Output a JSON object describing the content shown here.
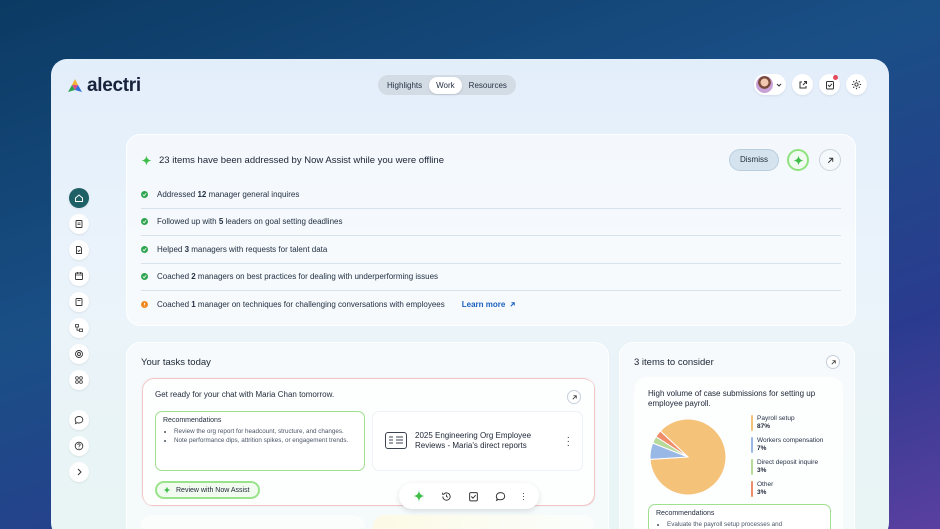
{
  "app": {
    "name": "alectri"
  },
  "nav": {
    "tabs": [
      {
        "label": "Highlights",
        "active": false
      },
      {
        "label": "Work",
        "active": true
      },
      {
        "label": "Resources",
        "active": false
      }
    ]
  },
  "assist": {
    "title": "23 items have been addressed by Now Assist while you were offline",
    "dismiss_label": "Dismiss",
    "items": [
      {
        "status": "done",
        "pre": "Addressed ",
        "num": "12",
        "post": " manager general inquires"
      },
      {
        "status": "done",
        "pre": "Followed up with ",
        "num": "5",
        "post": " leaders on goal setting deadlines"
      },
      {
        "status": "done",
        "pre": "Helped ",
        "num": "3",
        "post": " managers with requests for talent data"
      },
      {
        "status": "done",
        "pre": "Coached ",
        "num": "2",
        "post": " managers on best practices for dealing with underperforming issues"
      },
      {
        "status": "attention",
        "pre": "Coached ",
        "num": "1",
        "post": " manager on techniques for challenging conversations with employees"
      }
    ],
    "learn_more_label": "Learn more"
  },
  "tasks": {
    "title": "Your tasks today",
    "card": {
      "heading": "Get ready for your chat with Maria Chan tomorrow.",
      "recommendations_title": "Recommendations",
      "recommendations": [
        "Review the org report for headcount, structure, and changes.",
        "Note performance dips, attrition spikes, or engagement trends."
      ],
      "file_title": "2025 Engineering Org Employee Reviews  - Maria's direct reports",
      "review_button": "Review with Now Assist"
    }
  },
  "consider": {
    "title": "3 items to consider",
    "description": "High volume of case submissions for setting up employee payroll.",
    "chart_data": {
      "type": "pie",
      "categories": [
        "Payroll setup",
        "Workers compensation",
        "Direct deposit inquire",
        "Other"
      ],
      "values": [
        87,
        7,
        3,
        3
      ],
      "value_labels": [
        "87%",
        "7%",
        "3%",
        "3%"
      ],
      "colors": [
        "#f5c27a",
        "#9ab8e6",
        "#b7d99a",
        "#ef8c6a"
      ]
    },
    "recommendations_title": "Recommendations",
    "recommendations": [
      "Evaluate the payroll setup processes and"
    ]
  },
  "colors": {
    "accent": "#1f5f66",
    "success": "#2ea44f",
    "warning": "#f08a24",
    "link": "#1b5fbf"
  }
}
